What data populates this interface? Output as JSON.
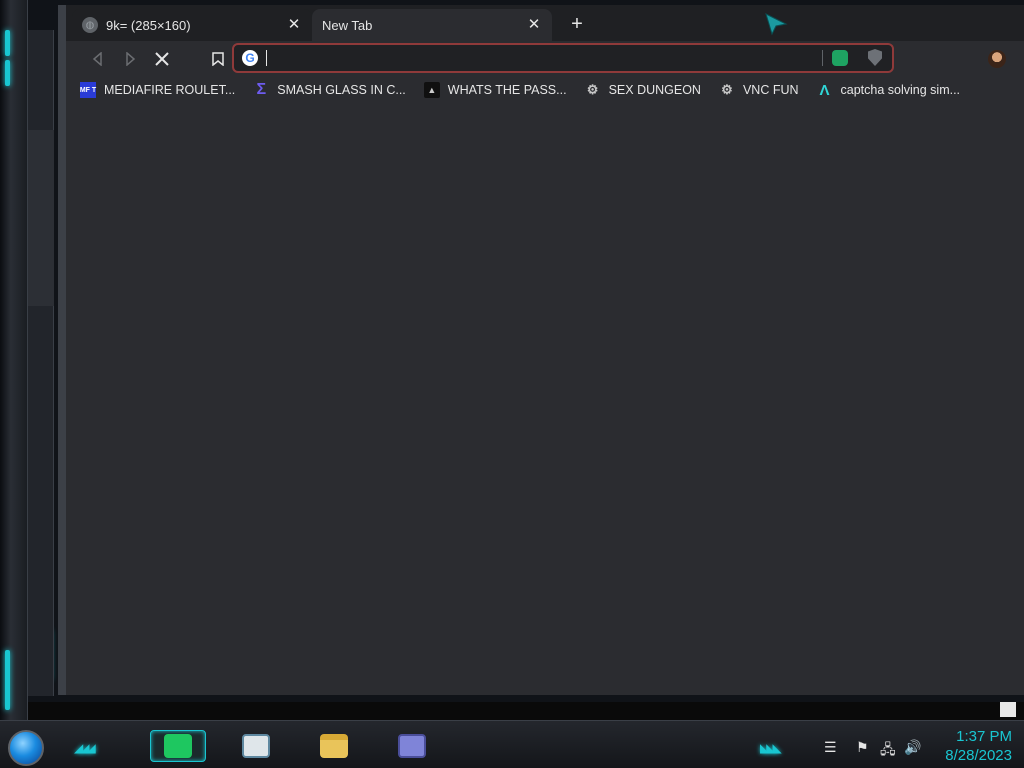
{
  "browser": {
    "tabs": [
      {
        "title": "9k= (285×160)",
        "active": true
      },
      {
        "title": "New Tab",
        "active": false
      }
    ],
    "omnibox": {
      "value": "",
      "placeholder": ""
    },
    "bookmarks": [
      {
        "label": "MEDIAFIRE ROULET...",
        "icon": "mediafire-icon",
        "icon_text": "MF T"
      },
      {
        "label": "SMASH GLASS IN C...",
        "icon": "sigma-icon"
      },
      {
        "label": "WHATS THE PASS...",
        "icon": "lock-icon"
      },
      {
        "label": "SEX DUNGEON",
        "icon": "robot-icon"
      },
      {
        "label": "VNC FUN",
        "icon": "robot-icon"
      },
      {
        "label": "captcha solving sim...",
        "icon": "lambda-icon"
      }
    ]
  },
  "taskbar": {
    "clock_time": "1:37 PM",
    "clock_date": "8/28/2023",
    "pinned": [
      "notes-app",
      "document-viewer",
      "file-explorer",
      "id-card-app"
    ]
  },
  "colors": {
    "accent": "#19c6d1",
    "omnibox_border": "#8f3a3a",
    "window_bg": "#2b2c30"
  }
}
